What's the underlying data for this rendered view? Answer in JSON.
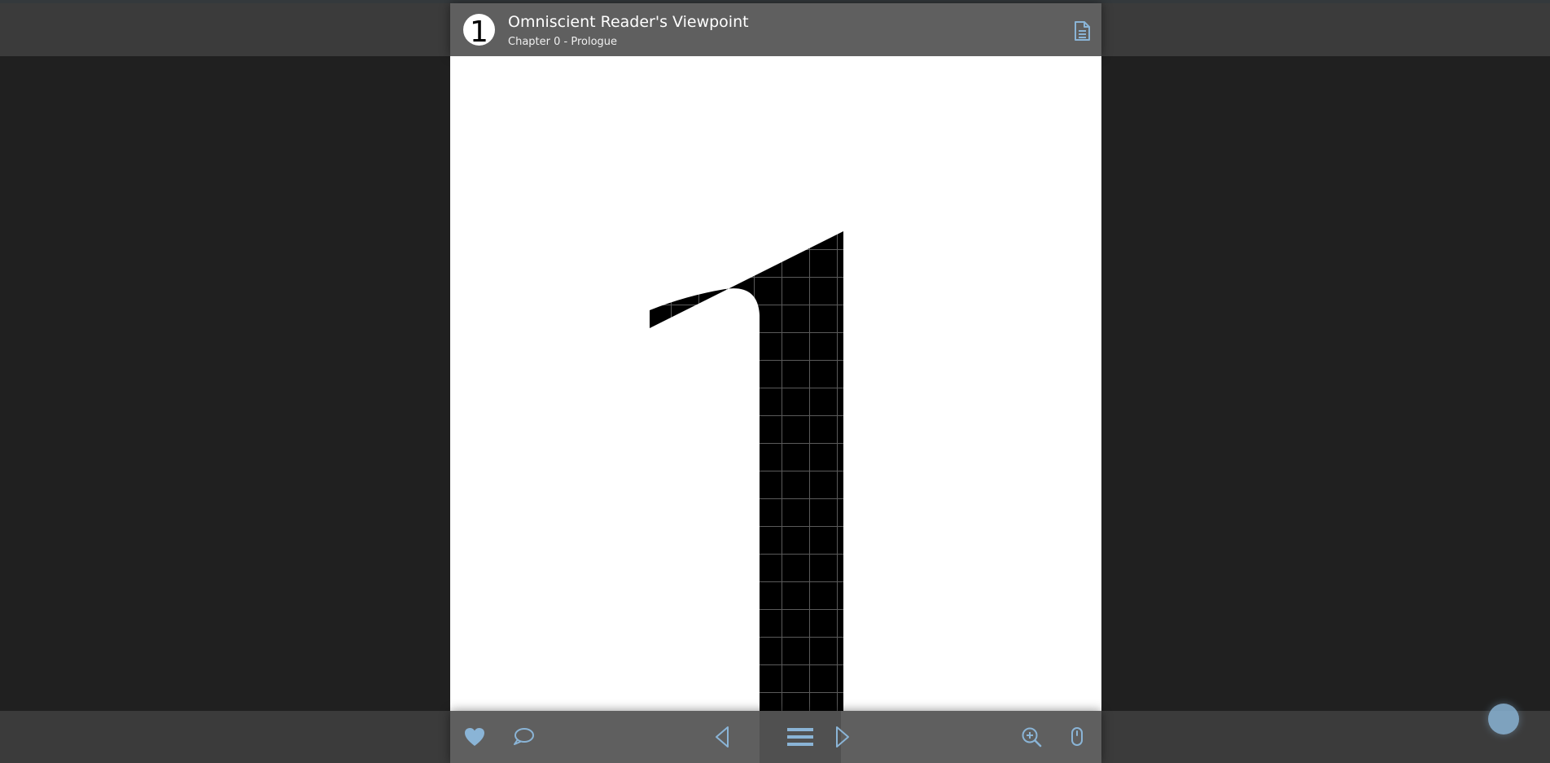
{
  "header": {
    "logo_text": "1",
    "title": "Omniscient Reader's Viewpoint",
    "subtitle": "Chapter 0 - Prologue"
  },
  "icons": {
    "logo": "one-circle-logo",
    "document": "document-icon",
    "favorite": "heart-icon",
    "comments": "comment-icon",
    "previous": "previous-arrow-icon",
    "menu": "menu-icon",
    "next": "next-arrow-icon",
    "zoom": "zoom-in-icon",
    "scroll": "mouse-icon",
    "fab": "scroll-top-icon"
  },
  "colors": {
    "accent": "#8ab4d6",
    "top_bar": "#5f5f5f",
    "side_background": "#202020",
    "page": "#ffffff"
  }
}
